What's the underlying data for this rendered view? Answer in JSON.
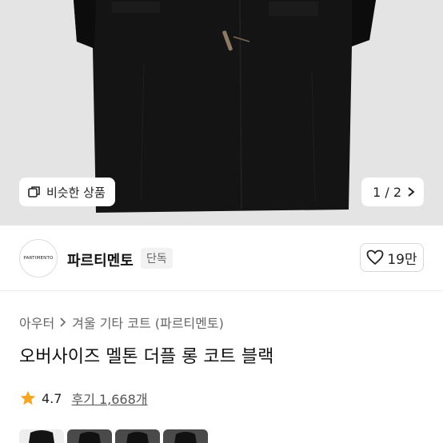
{
  "hero": {
    "similar_label": "비슷한 상품",
    "similar_icon": "similar-icon",
    "pager_text": "1 / 2",
    "pager_icon": "chevron-right-icon"
  },
  "brand": {
    "logo_text": "PARTIMENTO",
    "name": "파르티멘토",
    "badge": "단독",
    "like_icon": "heart-icon",
    "like_count": "19만"
  },
  "breadcrumb": {
    "category": "아우터",
    "subcategory": "겨울 기타 코트 (파르티멘토)"
  },
  "product": {
    "title": "오버사이즈 멜톤 더플 롱 코트 블랙",
    "rating": "4.7",
    "reviews": "후기 1,668개"
  },
  "colors": {
    "hero_bg": "#e4e4e4",
    "coat": "#141414",
    "star": "#f5a623",
    "thumb_selected_bg": "#eeeeee",
    "thumb_bg": "#4a4a4a"
  },
  "thumbnails": [
    "thumbnail-1",
    "thumbnail-2",
    "thumbnail-3",
    "thumbnail-4"
  ]
}
